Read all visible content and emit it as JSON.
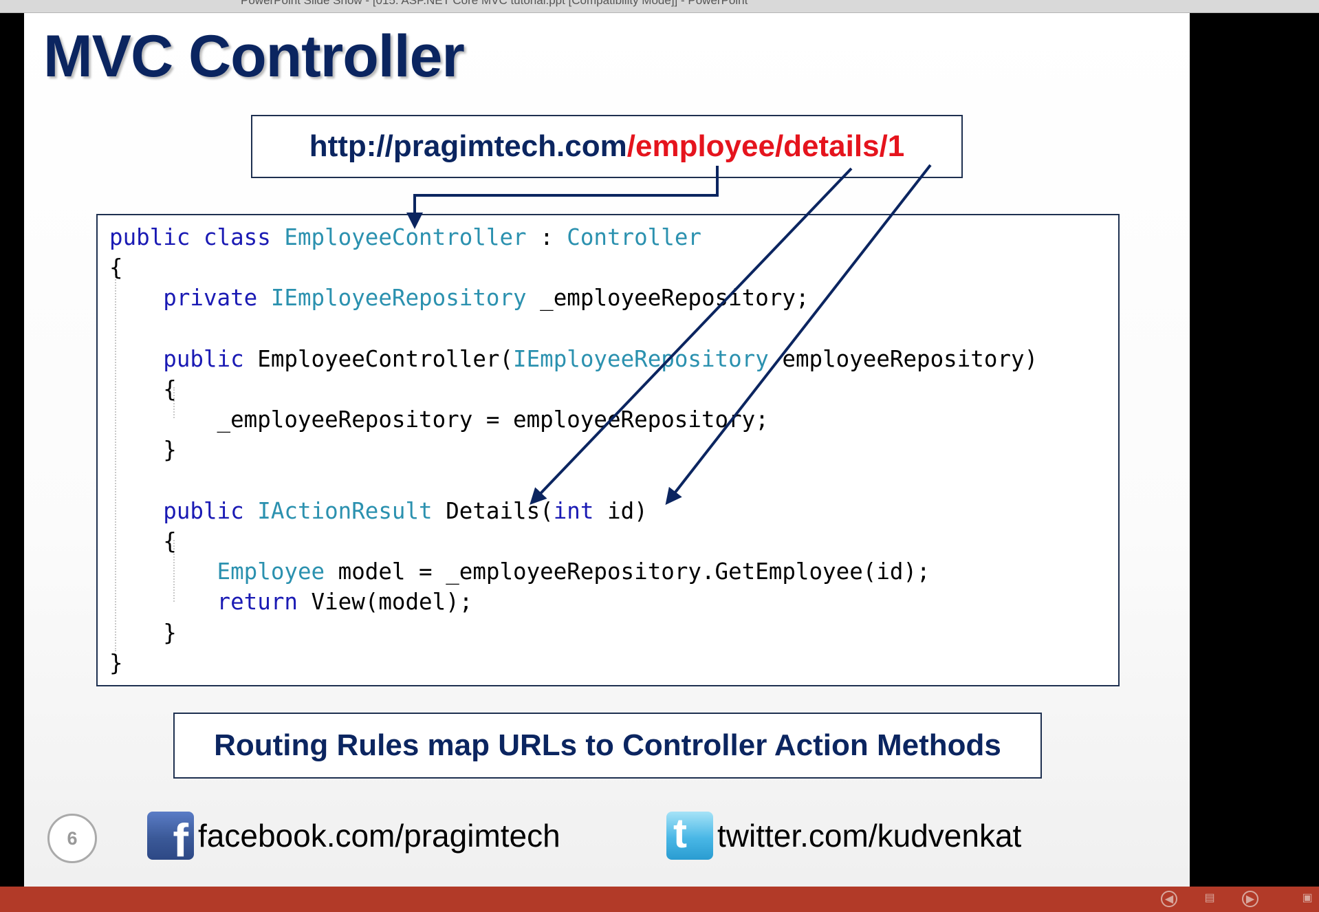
{
  "window": {
    "title": "PowerPoint Slide Show - [015. ASP.NET Core MVC tutorial.ppt [Compatibility Mode]] - PowerPoint"
  },
  "slide": {
    "title": "MVC Controller",
    "url": {
      "host": "http://pragimtech.com",
      "path": "/employee/details/1"
    },
    "code_lines": [
      [
        {
          "t": "public class ",
          "c": "kw"
        },
        {
          "t": "EmployeeController",
          "c": "ty"
        },
        {
          "t": " : "
        },
        {
          "t": "Controller",
          "c": "ty"
        }
      ],
      [
        {
          "t": "{"
        }
      ],
      [
        {
          "t": "    "
        },
        {
          "t": "private ",
          "c": "kw"
        },
        {
          "t": "IEmployeeRepository",
          "c": "ty"
        },
        {
          "t": " _employeeRepository;"
        }
      ],
      [
        {
          "t": ""
        }
      ],
      [
        {
          "t": "    "
        },
        {
          "t": "public ",
          "c": "kw"
        },
        {
          "t": "EmployeeController("
        },
        {
          "t": "IEmployeeRepository",
          "c": "ty"
        },
        {
          "t": " employeeRepository)"
        }
      ],
      [
        {
          "t": "    {"
        }
      ],
      [
        {
          "t": "        _employeeRepository = employeeRepository;"
        }
      ],
      [
        {
          "t": "    }"
        }
      ],
      [
        {
          "t": ""
        }
      ],
      [
        {
          "t": "    "
        },
        {
          "t": "public ",
          "c": "kw"
        },
        {
          "t": "IActionResult",
          "c": "ty"
        },
        {
          "t": " Details("
        },
        {
          "t": "int",
          "c": "kw"
        },
        {
          "t": " id)"
        }
      ],
      [
        {
          "t": "    {"
        }
      ],
      [
        {
          "t": "        "
        },
        {
          "t": "Employee",
          "c": "ty"
        },
        {
          "t": " model = _employeeRepository.GetEmployee(id);"
        }
      ],
      [
        {
          "t": "        "
        },
        {
          "t": "return ",
          "c": "kw"
        },
        {
          "t": "View(model);"
        }
      ],
      [
        {
          "t": "    }"
        }
      ],
      [
        {
          "t": "}"
        }
      ]
    ],
    "routing_note": "Routing Rules map URLs to Controller Action Methods",
    "page_number": "6",
    "facebook": {
      "icon": "facebook-icon",
      "text": "facebook.com/pragimtech"
    },
    "twitter": {
      "icon": "twitter-icon",
      "text": "twitter.com/kudvenkat"
    }
  },
  "controls": {
    "previous": "previous-slide-icon",
    "menu": "slide-menu-icon",
    "next": "next-slide-icon",
    "end": "end-show-icon"
  },
  "colors": {
    "title": "#0b2560",
    "url_path": "#e5141d",
    "code_keyword": "#1a1ab4",
    "code_type": "#2b91af",
    "bottom_bar": "#b23a28"
  }
}
